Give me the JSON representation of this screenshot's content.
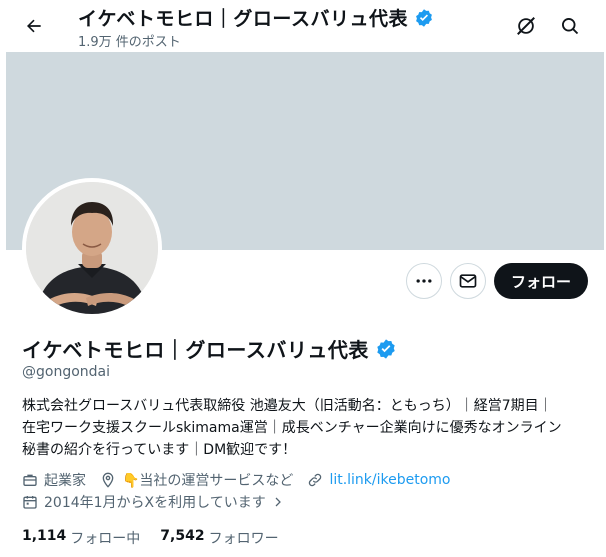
{
  "header": {
    "title": "イケベトモヒロ｜グロースバリュ代表",
    "post_count": "1.9万 件のポスト"
  },
  "actions": {
    "follow_label": "フォロー"
  },
  "profile": {
    "name": "イケベトモヒロ｜グロースバリュ代表",
    "handle": "@gongondai",
    "bio_lines": [
      "株式会社グロースバリュ代表取締役 池邉友大（旧活動名：ともっち）｜経営7期目｜",
      "在宅ワーク支援スクールskimama運営｜成長ベンチャー企業向けに優秀なオンライン",
      "秘書の紹介を行っています｜DM歓迎です！"
    ],
    "category": "起業家",
    "location": "👇当社の運営サービスなど",
    "website": "lit.link/ikebetomo",
    "joined": "2014年1月からXを利用しています"
  },
  "stats": {
    "following_count": "1,114",
    "following_label": "フォロー中",
    "followers_count": "7,542",
    "followers_label": "フォロワー"
  },
  "colors": {
    "accent": "#1d9bf0",
    "banner": "#cfd9de",
    "text": "#0f1419",
    "muted": "#536471"
  },
  "icons": [
    "back-arrow-icon",
    "verified-badge-icon",
    "grok-icon",
    "search-icon",
    "more-icon",
    "mail-icon",
    "briefcase-icon",
    "location-pin-icon",
    "link-icon",
    "calendar-icon"
  ]
}
